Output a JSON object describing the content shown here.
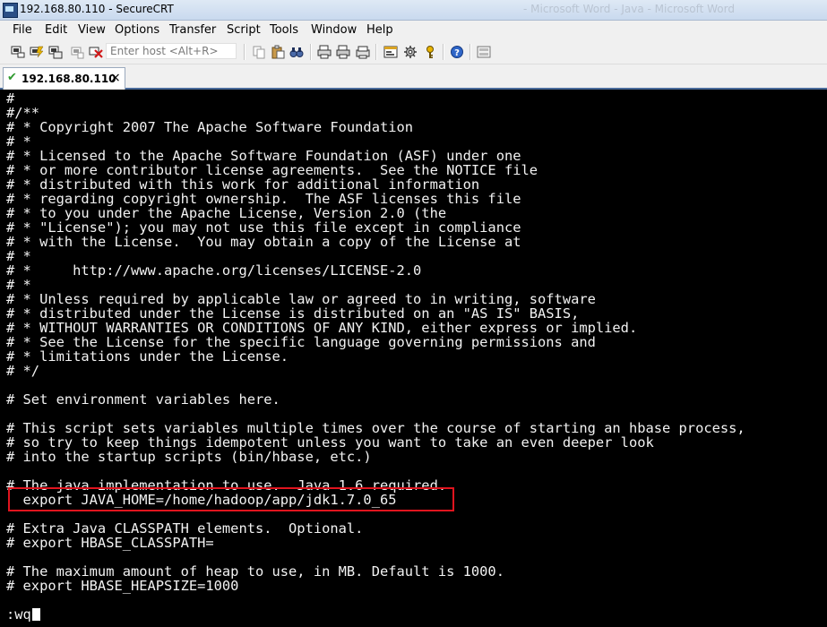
{
  "window": {
    "title": "192.168.80.110 - SecureCRT",
    "background_title": "- Microsoft Word - Java - Microsoft Word"
  },
  "menu": [
    "File",
    "Edit",
    "View",
    "Options",
    "Transfer",
    "Script",
    "Tools",
    "Window",
    "Help"
  ],
  "toolbar": {
    "host_placeholder": "Enter host <Alt+R>",
    "icons": [
      "connect-icon",
      "quick-connect-icon",
      "connect-tab-icon",
      "reconnect-icon",
      "disconnect-icon",
      "copy-icon",
      "paste-icon",
      "find-icon",
      "print-setup-icon",
      "print-icon",
      "print-screen-icon",
      "session-options-icon",
      "global-options-icon",
      "keymap-icon",
      "help-icon",
      "sftp-icon"
    ]
  },
  "tab": {
    "label": "192.168.80.110",
    "status": "connected",
    "close_glyph": "×"
  },
  "terminal": {
    "lines": [
      "#",
      "#/**",
      "# * Copyright 2007 The Apache Software Foundation",
      "# *",
      "# * Licensed to the Apache Software Foundation (ASF) under one",
      "# * or more contributor license agreements.  See the NOTICE file",
      "# * distributed with this work for additional information",
      "# * regarding copyright ownership.  The ASF licenses this file",
      "# * to you under the Apache License, Version 2.0 (the",
      "# * \"License\"); you may not use this file except in compliance",
      "# * with the License.  You may obtain a copy of the License at",
      "# *",
      "# *     http://www.apache.org/licenses/LICENSE-2.0",
      "# *",
      "# * Unless required by applicable law or agreed to in writing, software",
      "# * distributed under the License is distributed on an \"AS IS\" BASIS,",
      "# * WITHOUT WARRANTIES OR CONDITIONS OF ANY KIND, either express or implied.",
      "# * See the License for the specific language governing permissions and",
      "# * limitations under the License.",
      "# */",
      "",
      "# Set environment variables here.",
      "",
      "# This script sets variables multiple times over the course of starting an hbase process,",
      "# so try to keep things idempotent unless you want to take an even deeper look",
      "# into the startup scripts (bin/hbase, etc.)",
      "",
      "# The java implementation to use.  Java 1.6 required.",
      "  export JAVA_HOME=/home/hadoop/app/jdk1.7.0_65",
      "",
      "# Extra Java CLASSPATH elements.  Optional.",
      "# export HBASE_CLASSPATH=",
      "",
      "# The maximum amount of heap to use, in MB. Default is 1000.",
      "# export HBASE_HEAPSIZE=1000",
      "",
      ":wq"
    ],
    "highlight_color": "#e0141e"
  }
}
